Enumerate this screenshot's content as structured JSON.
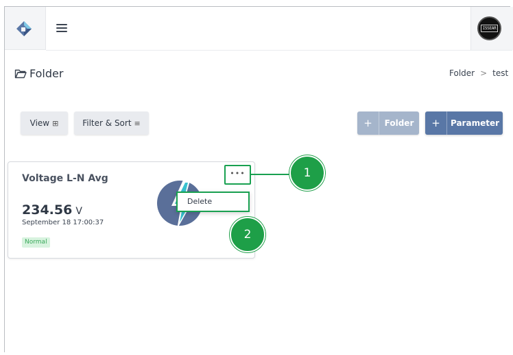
{
  "header": {
    "logo_icon": "diamond-logo-icon",
    "menu_icon": "hamburger-icon",
    "avatar_text": "ISSEAR"
  },
  "page": {
    "title": "Folder",
    "title_icon": "folder-icon",
    "breadcrumb": [
      "Folder",
      "test"
    ],
    "breadcrumb_separator": ">"
  },
  "toolbar": {
    "view_label": "View",
    "view_icon": "grid-icon",
    "filter_label": "Filter & Sort",
    "filter_icon": "sliders-icon",
    "folder_plus": "+",
    "folder_label": "Folder",
    "param_plus": "+",
    "param_label": "Parameter"
  },
  "card": {
    "title": "Voltage L-N Avg",
    "value": "234.56",
    "unit": "V",
    "timestamp": "September 18 17:00:37",
    "status": "Normal",
    "image_icon": "lightning-bolt-icon",
    "more_label": "•••",
    "menu_item": "Delete"
  },
  "annotations": {
    "step1": "1",
    "step2": "2"
  },
  "colors": {
    "accent": "#5977a6",
    "accent_light": "#a5b5cb",
    "callout": "#1e9f48",
    "status_bg": "#d8f3df",
    "status_text": "#39a85a"
  }
}
